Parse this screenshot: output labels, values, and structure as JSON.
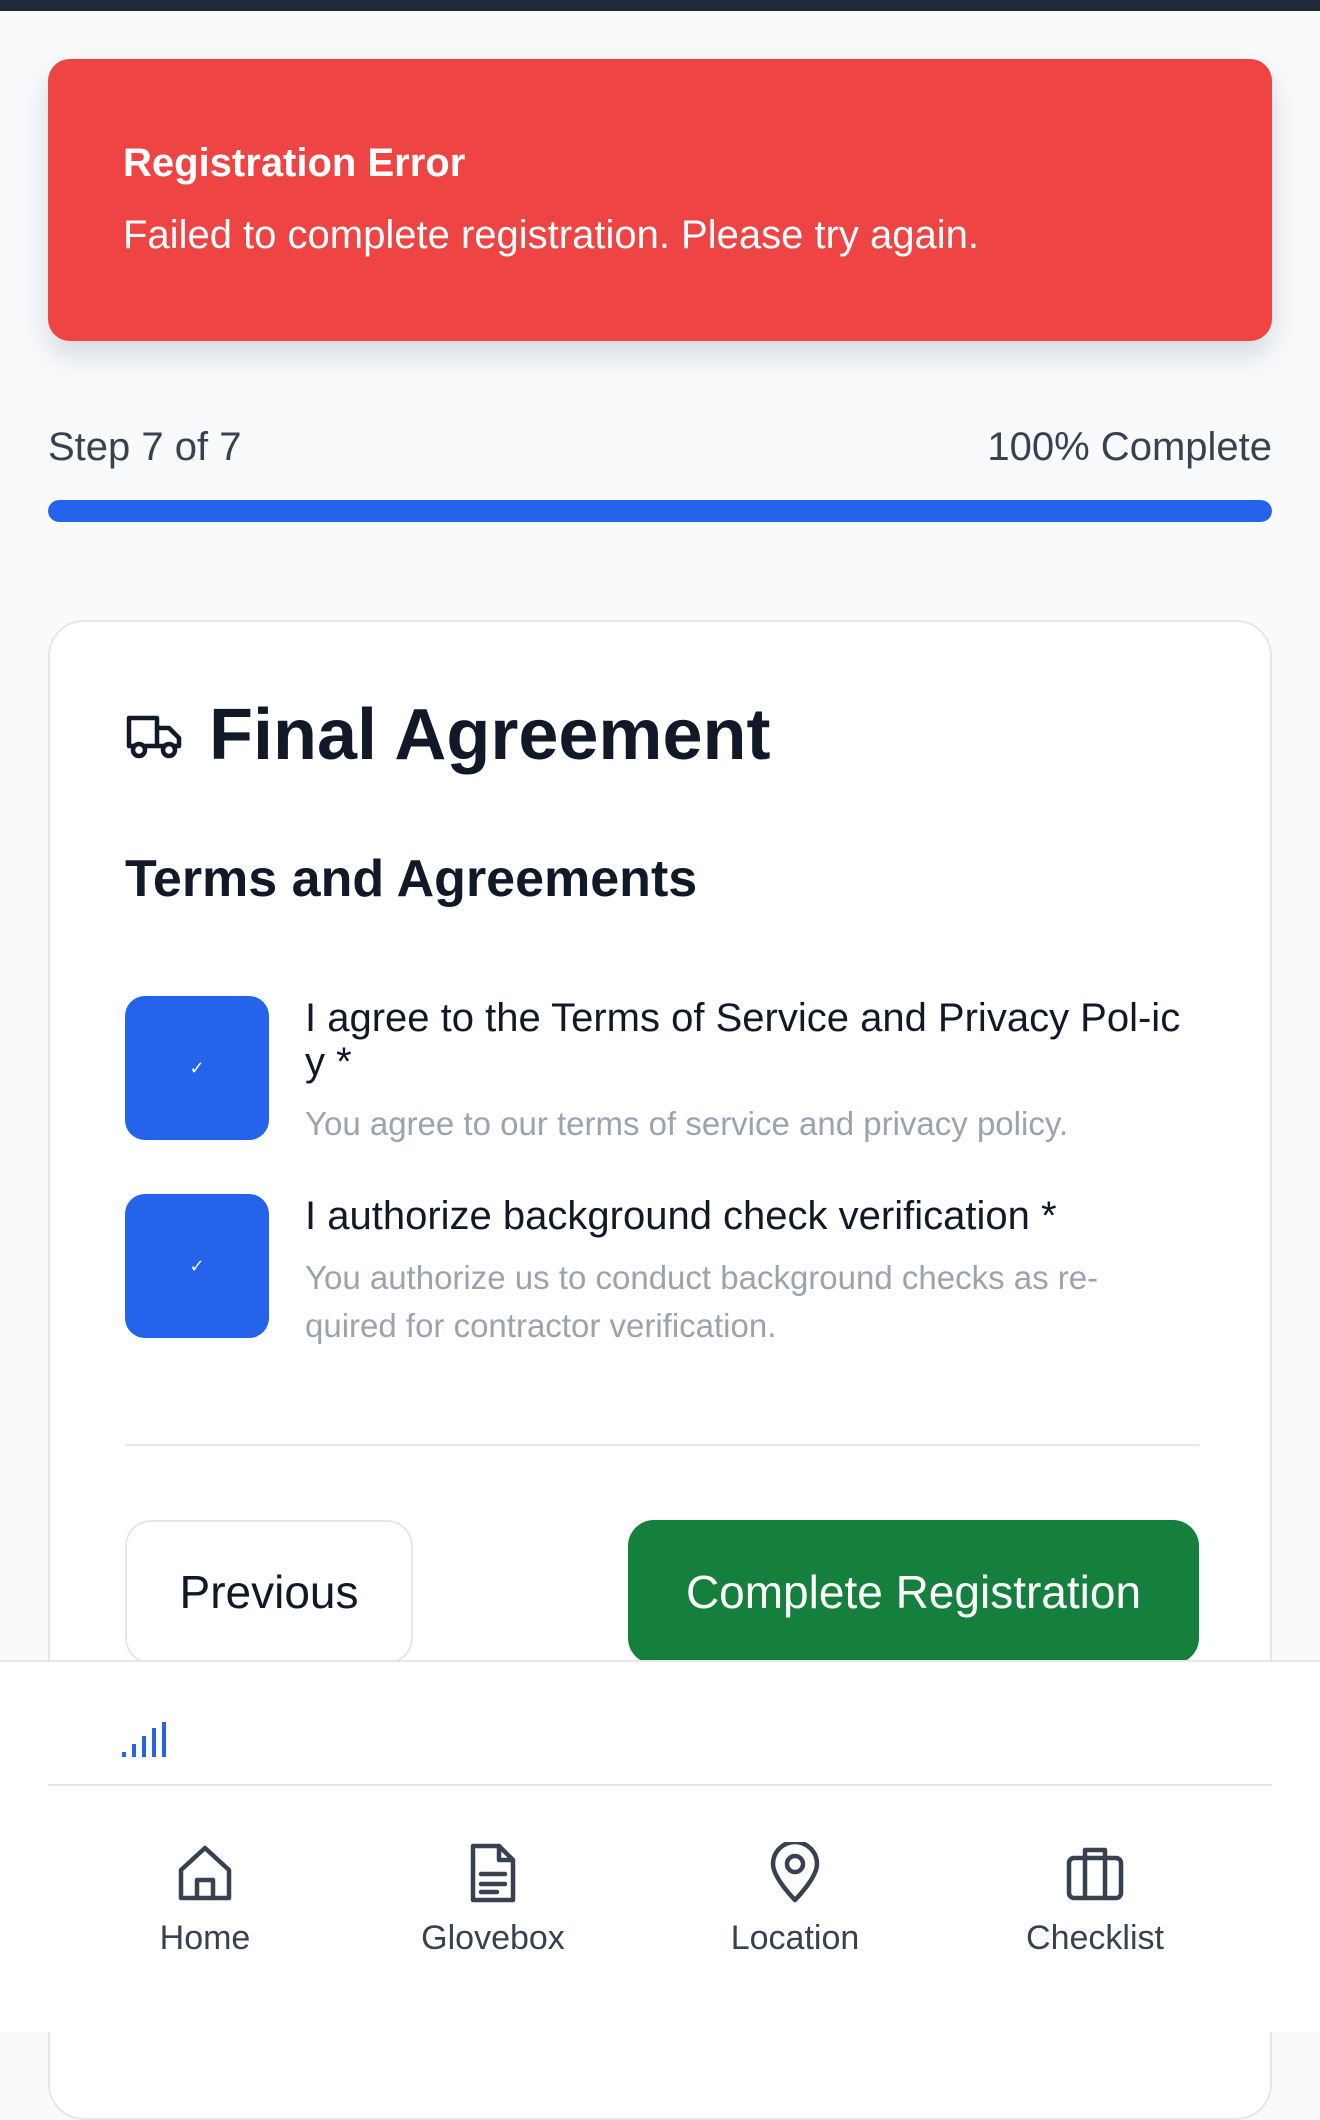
{
  "error": {
    "title": "Registration Error",
    "message": "Failed to complete registration. Please try again.",
    "color": "#ef4444"
  },
  "progress": {
    "step_text": "Step 7 of 7",
    "percent_text": "100% Complete",
    "percent": 100,
    "color": "#2563eb"
  },
  "card": {
    "title": "Final Agreement",
    "title_icon": "truck-icon",
    "section_title": "Terms and Agreements",
    "agreements": [
      {
        "label": "I agree to the Terms of Service and Privacy Pol-icy *",
        "description": "You agree to our terms of service and privacy policy.",
        "checked": true,
        "check_glyph": "✓"
      },
      {
        "label": "I authorize background check verification *",
        "description": "You authorize us to conduct background checks as re-quired for contractor verification.",
        "checked": true,
        "check_glyph": "✓"
      }
    ],
    "previous_label": "Previous",
    "complete_label": "Complete Registration",
    "complete_color": "#15803d"
  },
  "status": {
    "signal_icon": "signal-bars-icon"
  },
  "nav": {
    "items": [
      {
        "label": "Home",
        "icon": "home-icon"
      },
      {
        "label": "Glovebox",
        "icon": "document-icon"
      },
      {
        "label": "Location",
        "icon": "map-pin-icon"
      },
      {
        "label": "Checklist",
        "icon": "briefcase-icon"
      }
    ]
  }
}
